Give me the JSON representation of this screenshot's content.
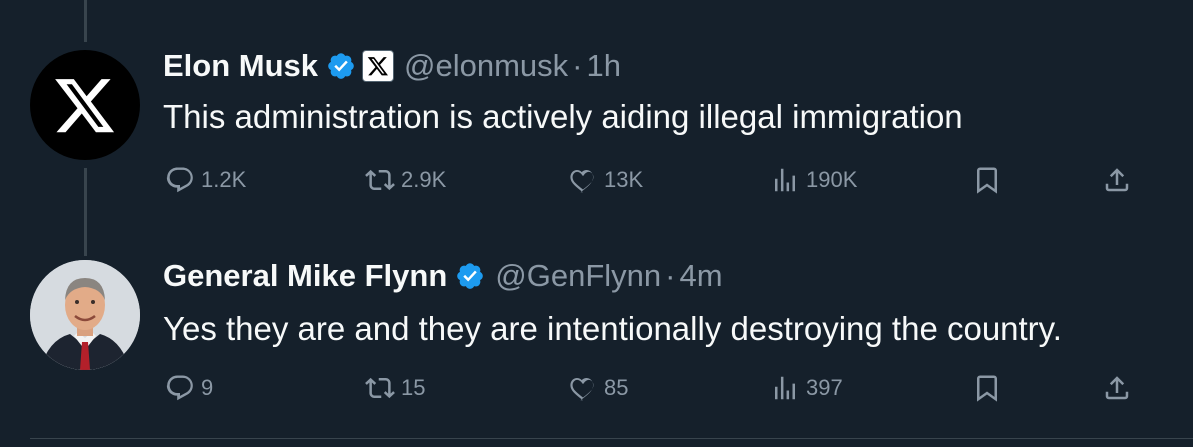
{
  "tweets": [
    {
      "name": "Elon Musk",
      "handle": "@elonmusk",
      "separator": "·",
      "time": "1h",
      "text": "This administration is actively aiding illegal immigration",
      "replies": "1.2K",
      "reposts": "2.9K",
      "likes": "13K",
      "views": "190K",
      "avatar_icon": "x-logo-icon",
      "affiliation_icon": "x-logo-icon"
    },
    {
      "name": "General Mike Flynn",
      "handle": "@GenFlynn",
      "separator": "·",
      "time": "4m",
      "text": "Yes they are and they are intentionally destroying the country.",
      "replies": "9",
      "reposts": "15",
      "likes": "85",
      "views": "397",
      "avatar_icon": "profile-photo"
    }
  ],
  "colors": {
    "background": "#15202b",
    "text_primary": "#f7f9f9",
    "text_secondary": "#8b98a5",
    "verified_blue": "#1d9bf0",
    "divider": "#38444d"
  }
}
